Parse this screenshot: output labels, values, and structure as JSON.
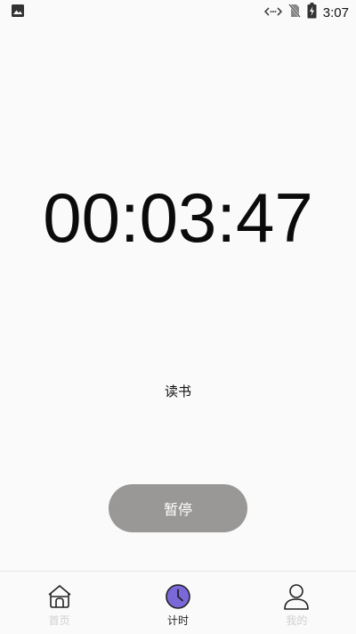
{
  "status_bar": {
    "time": "3:07",
    "icons": [
      "image-icon",
      "data-transfer-icon",
      "no-sim-icon",
      "battery-charging-icon"
    ]
  },
  "timer": {
    "elapsed": "00:03:47",
    "task_name": "读书"
  },
  "controls": {
    "pause_label": "暂停",
    "pause_color": "#9a9896"
  },
  "bottom_nav": {
    "items": [
      {
        "label": "首页",
        "icon": "home-icon",
        "active": false
      },
      {
        "label": "计时",
        "icon": "clock-icon",
        "active": true
      },
      {
        "label": "我的",
        "icon": "person-icon",
        "active": false
      }
    ],
    "active_color": "#7b68d8"
  }
}
